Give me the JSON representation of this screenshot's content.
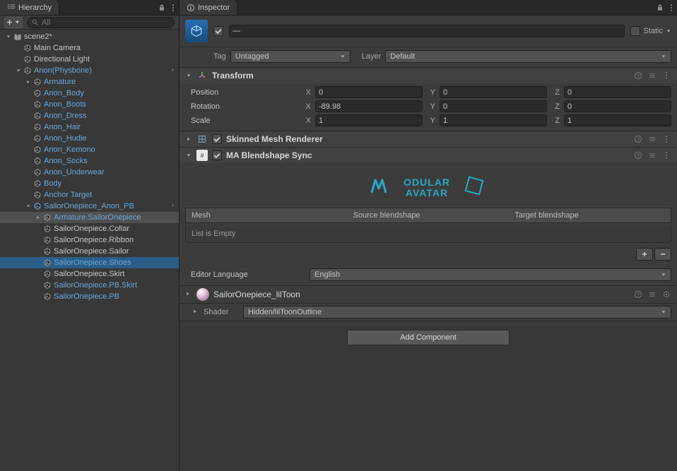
{
  "hierarchy": {
    "tab": "Hierarchy",
    "search_placeholder": "All",
    "tree": [
      {
        "d": 0,
        "f": "down",
        "t": "scene",
        "l": "scene2*"
      },
      {
        "d": 1,
        "t": "go",
        "l": "Main Camera"
      },
      {
        "d": 1,
        "t": "go",
        "l": "Directional Light"
      },
      {
        "d": 1,
        "f": "down",
        "t": "go",
        "l": "Anon(Physbone)",
        "link": true,
        "chev": true
      },
      {
        "d": 2,
        "f": "right",
        "t": "go",
        "l": "Armature",
        "link": true
      },
      {
        "d": 2,
        "t": "go",
        "l": "Anon_Body",
        "link": true
      },
      {
        "d": 2,
        "t": "go",
        "l": "Anon_Boots",
        "link": true
      },
      {
        "d": 2,
        "t": "go",
        "l": "Anon_Dress",
        "link": true,
        "faint": true
      },
      {
        "d": 2,
        "t": "go",
        "l": "Anon_Hair",
        "link": true
      },
      {
        "d": 2,
        "t": "go",
        "l": "Anon_Hudie",
        "link": true,
        "faint": true
      },
      {
        "d": 2,
        "t": "go",
        "l": "Anon_Kemono",
        "link": true
      },
      {
        "d": 2,
        "t": "go",
        "l": "Anon_Socks",
        "link": true
      },
      {
        "d": 2,
        "t": "go",
        "l": "Anon_Underwear",
        "link": true
      },
      {
        "d": 2,
        "t": "go",
        "l": "Body",
        "link": true
      },
      {
        "d": 2,
        "t": "go",
        "l": "Anchor Target",
        "link": true
      },
      {
        "d": 2,
        "f": "down",
        "t": "prefab",
        "l": "SailorOnepiece_Anon_PB",
        "link": true,
        "chev": true
      },
      {
        "d": 3,
        "f": "right",
        "t": "go",
        "l": "Armature.SailorOnepiece",
        "link": true,
        "sel": true
      },
      {
        "d": 3,
        "t": "go",
        "l": "SailorOnepiece.Collar"
      },
      {
        "d": 3,
        "t": "go",
        "l": "SailorOnepiece.Ribbon"
      },
      {
        "d": 3,
        "t": "go",
        "l": "SailorOnepiece.Sailor"
      },
      {
        "d": 3,
        "t": "go",
        "l": "SailorOnepiece.Shoes",
        "link": true,
        "hisel": true
      },
      {
        "d": 3,
        "t": "go",
        "l": "SailorOnepiece.Skirt"
      },
      {
        "d": 3,
        "t": "go",
        "l": "SailorOnepiece.PB.Skirt",
        "link": true
      },
      {
        "d": 3,
        "t": "go",
        "l": "SailorOnepiece.PB",
        "link": true
      }
    ]
  },
  "inspector": {
    "tab": "Inspector",
    "go_name": "—",
    "static_label": "Static",
    "tag_label": "Tag",
    "tag_value": "Untagged",
    "layer_label": "Layer",
    "layer_value": "Default",
    "transform": {
      "title": "Transform",
      "position": "Position",
      "rotation": "Rotation",
      "scale": "Scale",
      "vals": {
        "px": "0",
        "py": "0",
        "pz": "0",
        "rx": "-89.98",
        "ry": "0",
        "rz": "0",
        "sx": "1",
        "sy": "1",
        "sz": "1"
      }
    },
    "smr": {
      "title": "Skinned Mesh Renderer"
    },
    "ma": {
      "title": "MA Blendshape Sync",
      "logo": "Modular Avatar",
      "cols": {
        "mesh": "Mesh",
        "src": "Source blendshape",
        "tgt": "Target blendshape"
      },
      "empty": "List is Empty",
      "lang_label": "Editor Language",
      "lang_value": "English"
    },
    "material": {
      "name": "SailorOnepiece_lilToon",
      "shader_label": "Shader",
      "shader_value": "Hidden/lilToonOutline"
    },
    "add_component": "Add Component"
  }
}
